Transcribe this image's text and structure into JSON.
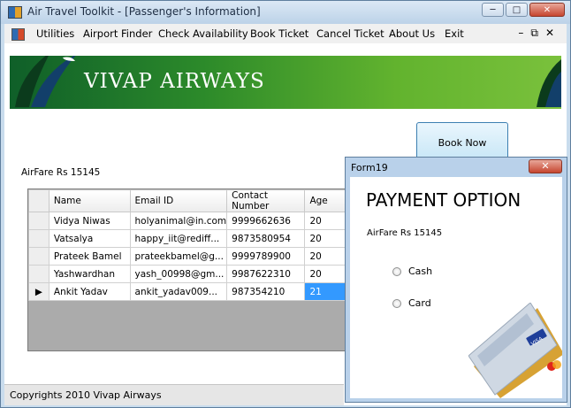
{
  "window": {
    "title": "Air Travel Toolkit - [Passenger's Information]"
  },
  "menu": {
    "items": [
      "Utilities",
      "Airport Finder",
      "Check Availability",
      "Book Ticket",
      "Cancel Ticket",
      "About Us",
      "Exit"
    ]
  },
  "banner": {
    "title": "VIVAP AIRWAYS"
  },
  "book_now_label": "Book Now",
  "airfare_text": "AirFare Rs 15145",
  "grid": {
    "columns": [
      "Name",
      "Email ID",
      "Contact Number",
      "Age"
    ],
    "rows": [
      [
        "Vidya Niwas",
        "holyanimal@in.com",
        "9999662636",
        "20"
      ],
      [
        "Vatsalya",
        "happy_iit@rediff...",
        "9873580954",
        "20"
      ],
      [
        "Prateek Bamel",
        "prateekbamel@g...",
        "9999789900",
        "20"
      ],
      [
        "Yashwardhan",
        "yash_00998@gm...",
        "9987622310",
        "20"
      ],
      [
        "Ankit Yadav",
        "ankit_yadav009...",
        "987354210",
        "21"
      ]
    ],
    "current_row_marker": "▶"
  },
  "status": {
    "text": "Copyrights 2010 Vivap Airways"
  },
  "form19": {
    "title": "Form19",
    "heading": "PAYMENT OPTION",
    "airfare_text": "AirFare Rs 15145",
    "options": [
      "Cash",
      "Card"
    ],
    "card_badge": "VISA"
  },
  "colors": {
    "banner_green": "#62b32e",
    "selection": "#3399ff",
    "title_bar": "#c9dced"
  }
}
